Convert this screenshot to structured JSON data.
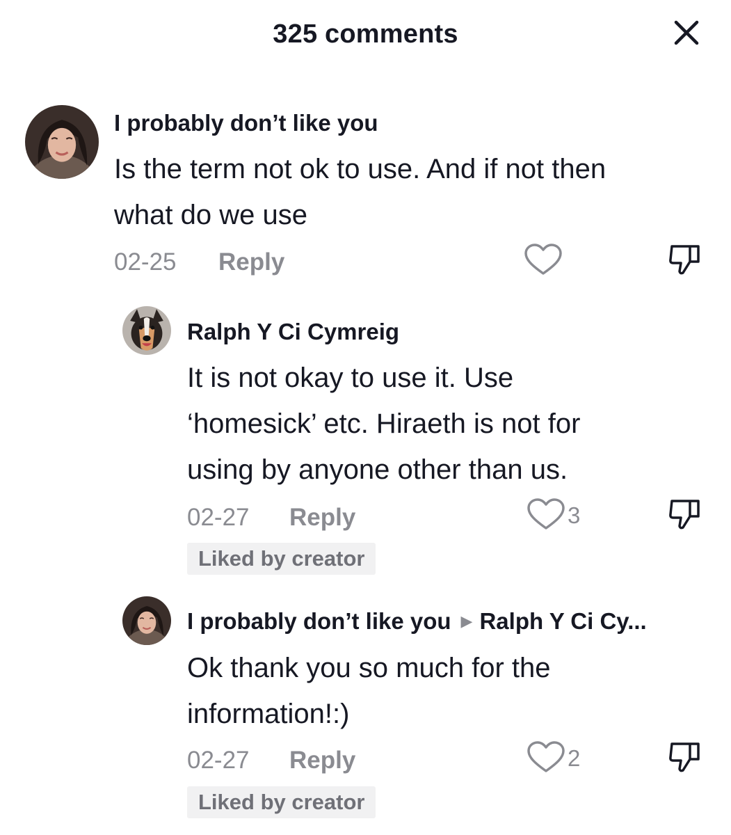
{
  "header": {
    "title": "325 comments",
    "close_icon": "close-icon"
  },
  "comments": [
    {
      "username": "I probably don’t like you",
      "text_lines": [
        "Is the term not ok to use. And if not then",
        "what do we use"
      ],
      "date": "02-25",
      "reply_label": "Reply",
      "like_count": ""
    },
    {
      "username": "Ralph Y Ci Cymreig",
      "text_lines": [
        "It is not okay to use it. Use",
        "‘homesick’ etc. Hiraeth is not for",
        "using by anyone other than us."
      ],
      "date": "02-27",
      "reply_label": "Reply",
      "like_count": "3",
      "badge": "Liked by creator"
    },
    {
      "username": "I probably don’t like you",
      "reply_to": "Ralph Y Ci Cy...",
      "text_lines": [
        "Ok thank you so much for the",
        "information!:)"
      ],
      "date": "02-27",
      "reply_label": "Reply",
      "like_count": "2",
      "badge": "Liked by creator"
    }
  ],
  "colors": {
    "text": "#161823",
    "muted": "#8a8b91",
    "badge_bg": "#f1f1f2"
  }
}
